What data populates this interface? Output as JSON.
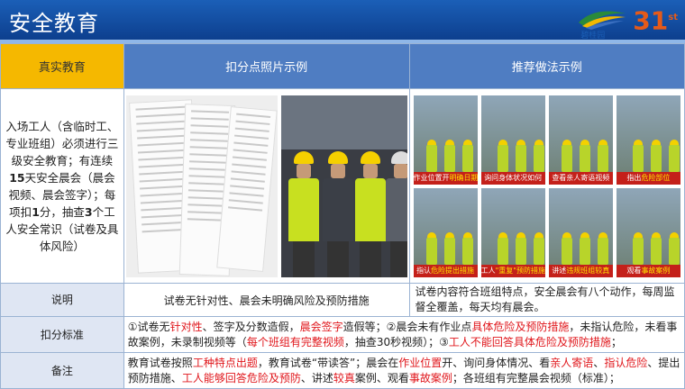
{
  "header": {
    "title": "安全教育",
    "logo_number": "31",
    "logo_sup": "st",
    "logo_text": "碧桂园"
  },
  "columns": {
    "col1": "真实教育",
    "col2": "扣分点照片示例",
    "col3": "推荐做法示例"
  },
  "intro": {
    "p1": "入场工人（含临时工、专业班组）必须进行三级安全教育；有连续",
    "p1_days": "15",
    "p2": "天安全晨会（晨会视频、晨会签字）；每项扣",
    "p2_points": "1",
    "p3": "分，抽查",
    "p3_count": "3",
    "p4": "个工人安全常识（试卷及具体风险）"
  },
  "recommend_tiles": [
    {
      "a": "作业位置开",
      "b": "明确日期"
    },
    {
      "a": "询问身体状况如何",
      "b": ""
    },
    {
      "a": "查看亲人寄语视频",
      "b": ""
    },
    {
      "a": "指出",
      "b": "危险部位"
    },
    {
      "a": "指认",
      "b": "危险提出措施"
    },
    {
      "a": "工人",
      "b": "\"重复\"预防措施"
    },
    {
      "a": "讲述",
      "b": "违规班组较真"
    },
    {
      "a": "观看",
      "b": "事故案例"
    }
  ],
  "rows": {
    "explain_label": "说明",
    "explain_col2": "试卷无针对性、晨会未明确风险及预防措施",
    "explain_col3": "试卷内容符合班组特点，安全晨会有八个动作，每周监督全覆盖，每天均有晨会。",
    "criteria_label": "扣分标准",
    "criteria": {
      "t1": "①试卷无",
      "r1": "针对性",
      "t2": "、签字及分数造假，",
      "r2": "晨会签字",
      "t3": "造假等；②晨会未有作业点",
      "r3": "具体危险及预防措施",
      "t4": "，未指认危险，未看事故案例，未录制视频等（",
      "r4": "每个班组有完整视频",
      "t5": "，抽查30秒视频）；③",
      "r5": "工人不能回答具体危险及预防措施",
      "t6": "；"
    },
    "remark_label": "备注",
    "remark": {
      "t1": "教育试卷按照",
      "r1": "工种特点出题",
      "t2": "，教育试卷“带读答”；晨会在",
      "r2": "作业位置",
      "t3": "开、询问身体情况、看",
      "r3": "亲人寄语",
      "t4": "、",
      "r4": "指认危险",
      "t5": "、提出预防措施、",
      "r5": "工人能够回答危险及预防",
      "t6": "、讲述",
      "r6": "较真",
      "t7": "案例、观看",
      "r7": "事故案例",
      "t8": "；各班组有完整晨会视频（标准）；"
    }
  }
}
